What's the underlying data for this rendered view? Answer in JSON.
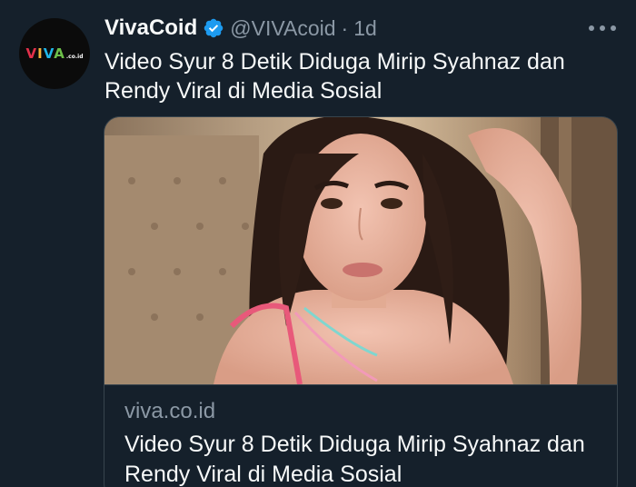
{
  "tweet": {
    "author": {
      "display_name": "VivaCoid",
      "handle": "@VIVAcoid",
      "verified": true,
      "avatar_logo": {
        "letters": [
          "V",
          "I",
          "V",
          "A"
        ],
        "suffix": ".co.id"
      }
    },
    "separator": "·",
    "time": "1d",
    "text": "Video Syur 8 Detik Diduga Mirip Syahnaz dan Rendy Viral di Media Sosial",
    "more_icon": "more-horizontal-icon",
    "card": {
      "image_alt": "photo-woman-selfie",
      "domain": "viva.co.id",
      "title": "Video Syur 8 Detik Diduga Mirip Syahnaz dan Rendy Viral di Media Sosial"
    },
    "colors": {
      "background": "#15202b",
      "text_primary": "#f7f9f9",
      "text_secondary": "#8b98a5",
      "verified_badge": "#1d9bf0",
      "card_border": "#38444d"
    }
  }
}
